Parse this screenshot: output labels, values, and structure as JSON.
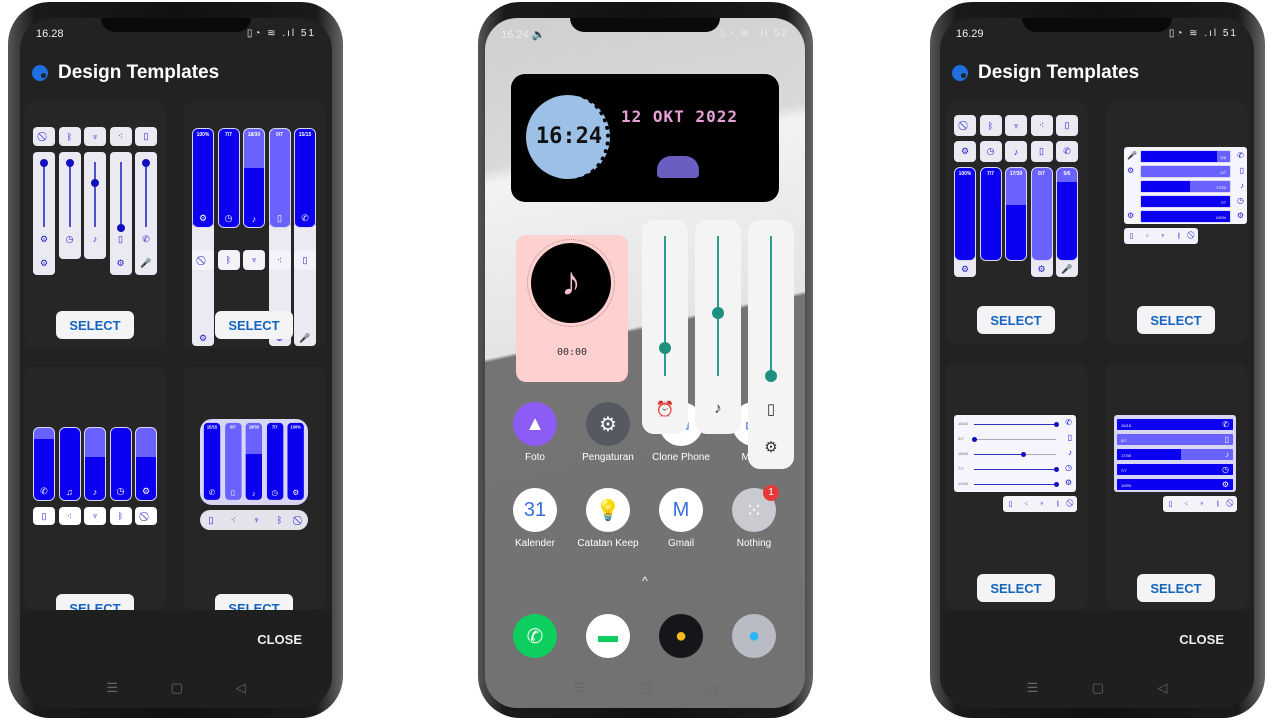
{
  "accent": "#0b00f0",
  "accent_light": "#6a62ff",
  "select_color": "#1565c0",
  "left_phone": {
    "time": "16.28",
    "battery": "51",
    "title": "Design Templates",
    "close": "CLOSE",
    "cards": [
      {
        "type": "vertical-sliders",
        "select": "SELECT",
        "values": [
          1.0,
          1.0,
          0.7,
          0.0,
          1.0
        ]
      },
      {
        "type": "vertical-bars-labeled",
        "select": "SELECT",
        "labels": [
          "100%",
          "7/7",
          "18/30",
          "0/7",
          "15/15"
        ],
        "values": [
          1.0,
          1.0,
          0.6,
          0.0,
          1.0
        ]
      },
      {
        "type": "vertical-bars",
        "select": "SELECT",
        "values": [
          0.85,
          1.0,
          0.6,
          1.0,
          0.6
        ]
      },
      {
        "type": "vertical-bars-grouped",
        "select": "SELECT",
        "labels": [
          "15/15",
          "0/7",
          "18/30",
          "7/7",
          "100%"
        ],
        "values": [
          1.0,
          0.0,
          0.6,
          1.0,
          1.0
        ]
      }
    ]
  },
  "right_phone": {
    "time": "16.29",
    "battery": "51",
    "title": "Design Templates",
    "close": "CLOSE",
    "cards": [
      {
        "type": "vertical-bars-two-rows",
        "select": "SELECT",
        "labels": [
          "100%",
          "7/7",
          "17/30",
          "0/7",
          "5/6"
        ],
        "values": [
          1.0,
          1.0,
          0.6,
          0.0,
          0.85
        ]
      },
      {
        "type": "horizontal-bars",
        "select": "SELECT",
        "labels": [
          "5/6",
          "0/7",
          "17/30",
          "7/7",
          "100%"
        ],
        "values": [
          0.85,
          0.0,
          0.55,
          1.0,
          1.0
        ]
      },
      {
        "type": "horizontal-sliders",
        "select": "SELECT",
        "labels": [
          "15/15",
          "0/7",
          "18/30",
          "7/7",
          "100%"
        ],
        "values": [
          1.0,
          0.0,
          0.6,
          1.0,
          1.0
        ]
      },
      {
        "type": "horizontal-bars-full",
        "select": "SELECT",
        "labels": [
          "15/15",
          "0/7",
          "17/30",
          "7/7",
          "100%"
        ],
        "values": [
          1.0,
          0.0,
          0.55,
          1.0,
          1.0
        ]
      }
    ]
  },
  "middle_phone": {
    "time": "16.24",
    "battery": "52",
    "clock_widget": {
      "time": "16:24",
      "date": "12 OKT 2022"
    },
    "music_widget": {
      "time": "00:00"
    },
    "volume_panels": [
      {
        "icon": "alarm-icon",
        "glyph": "⏰",
        "value": 0.2
      },
      {
        "icon": "music-icon",
        "glyph": "♪",
        "value": 0.45
      },
      {
        "icon": "vibrate-icon",
        "glyph": "▯",
        "value": 0.0
      }
    ],
    "apps_row1": [
      {
        "label": "Foto",
        "bg": "#8b5cf6",
        "glyph": "▲"
      },
      {
        "label": "Pengaturan",
        "bg": "#555a62",
        "glyph": "⚙"
      },
      {
        "label": "Clone Phone",
        "bg": "#ffffff",
        "glyph": "▭"
      },
      {
        "label": "Mana",
        "bg": "#ffffff",
        "glyph": "▭"
      }
    ],
    "apps_row2": [
      {
        "label": "Kalender",
        "bg": "#ffffff",
        "glyph": "31"
      },
      {
        "label": "Catatan Keep",
        "bg": "#ffffff",
        "glyph": "💡"
      },
      {
        "label": "Gmail",
        "bg": "#ffffff",
        "glyph": "M"
      },
      {
        "label": "Nothing",
        "bg": "#c9cbd0",
        "glyph": "⁙",
        "badge": "1"
      }
    ],
    "dock": [
      {
        "name": "phone",
        "bg": "#0dcf5f",
        "glyph": "✆"
      },
      {
        "name": "messages",
        "bg": "#ffffff",
        "glyph": "▬"
      },
      {
        "name": "music",
        "bg": "#15161a",
        "glyph": "●"
      },
      {
        "name": "camera",
        "bg": "#b9bcc4",
        "glyph": "●"
      }
    ]
  },
  "icons": {
    "top": [
      "⃠",
      "ᛒ",
      "♆",
      "⁖",
      "▯"
    ],
    "mid": [
      "⚙",
      "◷",
      "♪",
      "▯",
      "✆"
    ]
  }
}
